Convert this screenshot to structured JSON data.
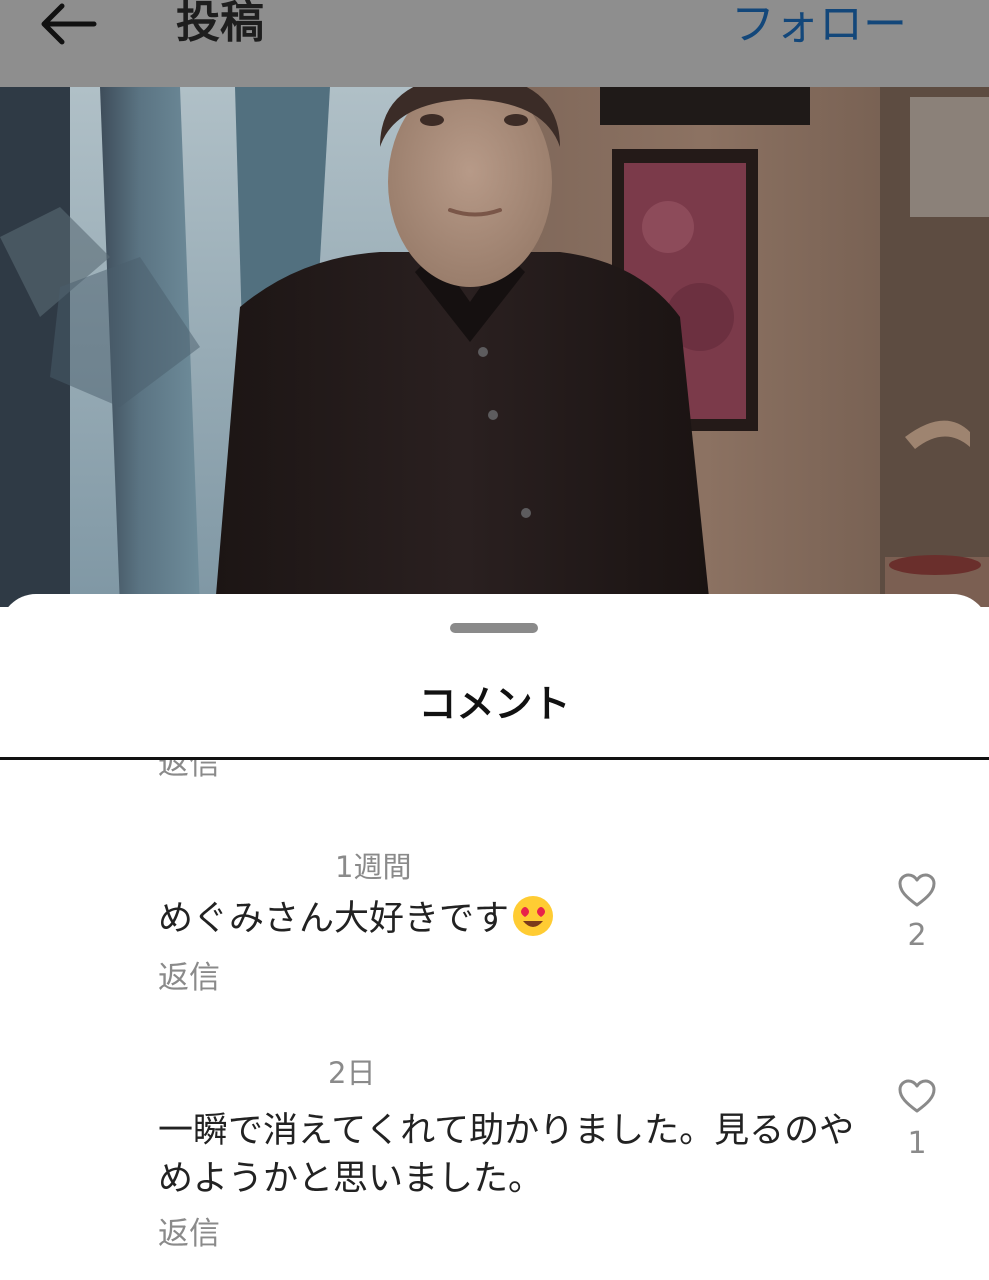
{
  "header": {
    "back_icon": "arrow-left-icon",
    "title": "投稿",
    "follow_label": "フォロー",
    "follow_color": "#13477a"
  },
  "post": {
    "image": "photo of a woman in a dark shirt in a room with framed pictures"
  },
  "sheet": {
    "title": "コメント"
  },
  "comments": [
    {
      "reply_label": "返信"
    },
    {
      "time": "1週間",
      "text": "めぐみさん大好きです",
      "emoji": "heart-eyes-emoji",
      "likes": "2",
      "reply_label": "返信"
    },
    {
      "time": "2日",
      "text": "一瞬で消えてくれて助かりました。見るのやめようかと思いました。",
      "likes": "1",
      "reply_label": "返信"
    }
  ]
}
